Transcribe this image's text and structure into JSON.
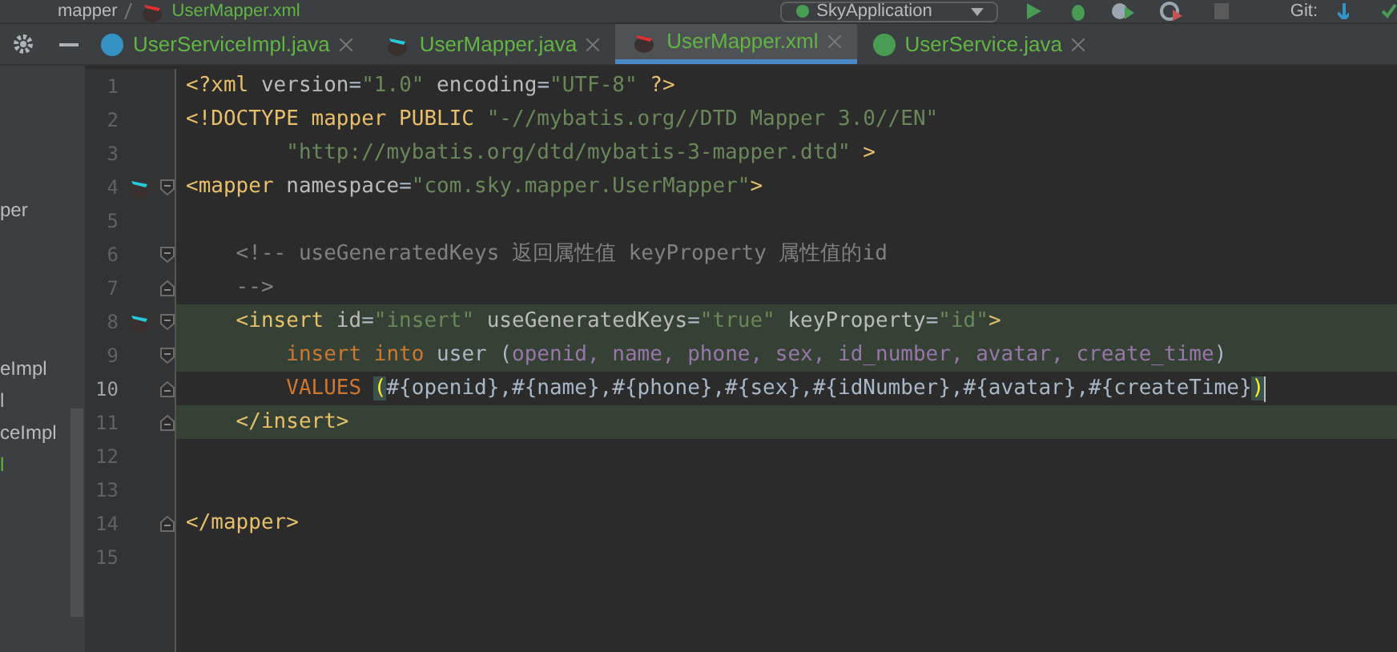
{
  "breadcrumb": [
    {
      "text": "mapper",
      "kind": "folder"
    },
    {
      "text": "UserMapper.xml",
      "kind": "file"
    }
  ],
  "run_config": "SkyApplication",
  "vcs_label": "Git:",
  "project_items": [
    {
      "text": "per",
      "modified": false
    },
    {
      "text": "eImpl",
      "modified": false
    },
    {
      "text": "l",
      "modified": false
    },
    {
      "text": "ceImpl",
      "modified": false
    },
    {
      "text": "l",
      "modified": true
    }
  ],
  "tabs": [
    {
      "label": "UserServiceImpl.java",
      "kind": "class",
      "selected": false
    },
    {
      "label": "UserMapper.java",
      "kind": "mapper",
      "selected": false
    },
    {
      "label": "UserMapper.xml",
      "kind": "xml",
      "selected": true
    },
    {
      "label": "UserService.java",
      "kind": "interface",
      "selected": false
    }
  ],
  "lines": [
    {
      "number": "1",
      "tokens": [
        {
          "text": "<?xml ",
          "kind": "tag"
        },
        {
          "text": "version",
          "kind": "attr"
        },
        {
          "text": "=",
          "kind": "plain"
        },
        {
          "text": "\"1.0\"",
          "kind": "str"
        },
        {
          "text": " encoding",
          "kind": "attr"
        },
        {
          "text": "=",
          "kind": "plain"
        },
        {
          "text": "\"UTF-8\"",
          "kind": "str"
        },
        {
          "text": " ?>",
          "kind": "tag"
        }
      ]
    },
    {
      "number": "2",
      "tokens": [
        {
          "text": "<!DOCTYPE mapper PUBLIC ",
          "kind": "tag"
        },
        {
          "text": "\"-//mybatis.org//DTD Mapper 3.0//EN\"",
          "kind": "str"
        }
      ]
    },
    {
      "number": "3",
      "tokens": [
        {
          "text": "        \"http://mybatis.org/dtd/mybatis-3-mapper.dtd\"",
          "kind": "str"
        },
        {
          "text": " >",
          "kind": "tag"
        }
      ]
    },
    {
      "number": "4",
      "marker": true,
      "fold_start": true,
      "tokens": [
        {
          "text": "<mapper ",
          "kind": "tag"
        },
        {
          "text": "namespace",
          "kind": "attr"
        },
        {
          "text": "=",
          "kind": "plain"
        },
        {
          "text": "\"com.sky.mapper.UserMapper\"",
          "kind": "str"
        },
        {
          "text": ">",
          "kind": "tag"
        }
      ]
    },
    {
      "number": "5"
    },
    {
      "number": "6",
      "fold_start": true,
      "tokens": [
        {
          "text": "    <!-- useGeneratedKeys 返回属性值 keyProperty 属性值的id",
          "kind": "comment"
        }
      ]
    },
    {
      "number": "7",
      "fold_end": true,
      "tokens": [
        {
          "text": "    -->",
          "kind": "comment"
        }
      ]
    },
    {
      "number": "8",
      "marker": true,
      "fold_start": true,
      "shaded": true,
      "tokens": [
        {
          "text": "    <insert ",
          "kind": "tag"
        },
        {
          "text": "id",
          "kind": "attr"
        },
        {
          "text": "=",
          "kind": "plain"
        },
        {
          "text": "\"insert\"",
          "kind": "str"
        },
        {
          "text": " useGeneratedKeys",
          "kind": "attr"
        },
        {
          "text": "=",
          "kind": "plain"
        },
        {
          "text": "\"true\"",
          "kind": "str"
        },
        {
          "text": " keyProperty",
          "kind": "attr"
        },
        {
          "text": "=",
          "kind": "plain"
        },
        {
          "text": "\"id\"",
          "kind": "str"
        },
        {
          "text": ">",
          "kind": "tag"
        }
      ]
    },
    {
      "number": "9",
      "fold_start": true,
      "shaded": true,
      "tokens": [
        {
          "text": "        insert into ",
          "kind": "kw"
        },
        {
          "text": "user ",
          "kind": "plain"
        },
        {
          "text": "(",
          "kind": "plain"
        },
        {
          "text": "openid, name, phone, sex, id_number, avatar, create_time",
          "kind": "col"
        },
        {
          "text": ")",
          "kind": "plain"
        }
      ]
    },
    {
      "number": "10",
      "fold_end": true,
      "current": true,
      "tokens": [
        {
          "text": "        VALUES ",
          "kind": "kw"
        },
        {
          "text": "(",
          "kind": "brace"
        },
        {
          "text": "#{openid},#{name},#{phone},#{sex},#{idNumber},#{avatar},#{createTime}",
          "kind": "plain"
        },
        {
          "text": ")",
          "kind": "brace"
        }
      ]
    },
    {
      "number": "11",
      "fold_end": true,
      "shaded": true,
      "tokens": [
        {
          "text": "    </insert>",
          "kind": "tag"
        }
      ]
    },
    {
      "number": "12"
    },
    {
      "number": "13"
    },
    {
      "number": "14",
      "fold_end": true,
      "tokens": [
        {
          "text": "</mapper>",
          "kind": "tag"
        }
      ]
    },
    {
      "number": "15"
    }
  ]
}
